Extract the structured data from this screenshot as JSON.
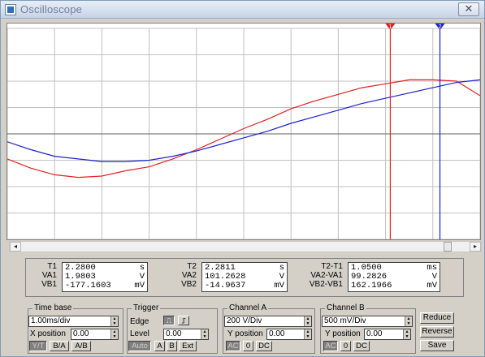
{
  "window": {
    "title": "Oscilloscope",
    "close_glyph": "✕"
  },
  "icons": {
    "app": "oscilloscope-app-icon",
    "close": "close-icon",
    "scroll_left": "arrow-left-icon",
    "scroll_right": "arrow-right-icon",
    "edge_rising": "rising-edge-icon",
    "edge_falling": "falling-edge-icon",
    "spin_arrows": "spin-arrows-icon"
  },
  "colors": {
    "channel_a": "#e02020",
    "channel_b": "#2020d0",
    "grid": "#c0c0c0",
    "center_line": "#606060"
  },
  "cursors": {
    "t1_label": "1",
    "t2_label": "2"
  },
  "scrollbar": {
    "left_glyph": "◂",
    "right_glyph": "▸",
    "position": 0.95
  },
  "measurements": {
    "t1": {
      "labels": [
        "T1",
        "VA1",
        "VB1"
      ],
      "values": [
        "2.2800",
        "1.9803",
        "-177.1603"
      ],
      "units": [
        "s",
        "V",
        "mV"
      ]
    },
    "t2": {
      "labels": [
        "T2",
        "VA2",
        "VB2"
      ],
      "values": [
        "2.2811",
        "101.2628",
        "-14.9637"
      ],
      "units": [
        "s",
        "V",
        "mV"
      ]
    },
    "diff": {
      "labels": [
        "T2-T1",
        "VA2-VA1",
        "VB2-VB1"
      ],
      "values": [
        "1.0500",
        "99.2826",
        "162.1966"
      ],
      "units": [
        "ms",
        "V",
        "mV"
      ]
    }
  },
  "timebase": {
    "title": "Time base",
    "scale": "1.00ms/div",
    "x_position_label": "X position",
    "x_position": "0.00",
    "buttons": [
      "Y/T",
      "B/A",
      "A/B"
    ]
  },
  "trigger": {
    "title": "Trigger",
    "edge_label": "Edge",
    "level_label": "Level",
    "level": "0.00",
    "buttons": [
      "Auto",
      "A",
      "B",
      "Ext"
    ]
  },
  "channel_a": {
    "title": "Channel A",
    "scale": "200 V/Div",
    "y_position_label": "Y position",
    "y_position": "0.00",
    "buttons": [
      "AC",
      "0",
      "DC"
    ]
  },
  "channel_b": {
    "title": "Channel B",
    "scale": "500 mV/Div",
    "y_position_label": "Y position",
    "y_position": "0.00",
    "buttons": [
      "AC",
      "0",
      "DC"
    ]
  },
  "actions": {
    "reduce": "Reduce",
    "reverse": "Reverse",
    "save": "Save"
  },
  "chart_data": {
    "type": "line",
    "grid": true,
    "divisions": {
      "x": 10,
      "y": 8
    },
    "series": [
      {
        "channel": "A",
        "color": "#e02020",
        "x": [
          0,
          0.5,
          1,
          1.5,
          2,
          2.5,
          3,
          3.5,
          4,
          4.5,
          5,
          5.5,
          6,
          6.5,
          7,
          7.5,
          8,
          8.5,
          9,
          9.5,
          10
        ],
        "y": [
          -0.95,
          -1.3,
          -1.55,
          -1.65,
          -1.6,
          -1.4,
          -1.25,
          -0.95,
          -0.6,
          -0.2,
          0.2,
          0.55,
          0.95,
          1.25,
          1.5,
          1.75,
          1.9,
          2.05,
          2.05,
          2.0,
          1.45
        ]
      },
      {
        "channel": "B",
        "color": "#2020d0",
        "x": [
          0,
          0.5,
          1,
          1.5,
          2,
          2.5,
          3,
          3.5,
          4,
          4.5,
          5,
          5.5,
          6,
          6.5,
          7,
          7.5,
          8,
          8.5,
          9,
          9.5,
          10
        ],
        "y": [
          -0.3,
          -0.6,
          -0.85,
          -0.95,
          -1.05,
          -1.05,
          -1.0,
          -0.85,
          -0.65,
          -0.4,
          -0.15,
          0.1,
          0.4,
          0.65,
          0.9,
          1.15,
          1.35,
          1.55,
          1.75,
          1.95,
          2.05
        ]
      }
    ],
    "cursors": [
      {
        "label": "1",
        "x": 8.1,
        "color": "#e02020"
      },
      {
        "label": "2",
        "x": 9.15,
        "color": "#2020d0"
      }
    ]
  }
}
